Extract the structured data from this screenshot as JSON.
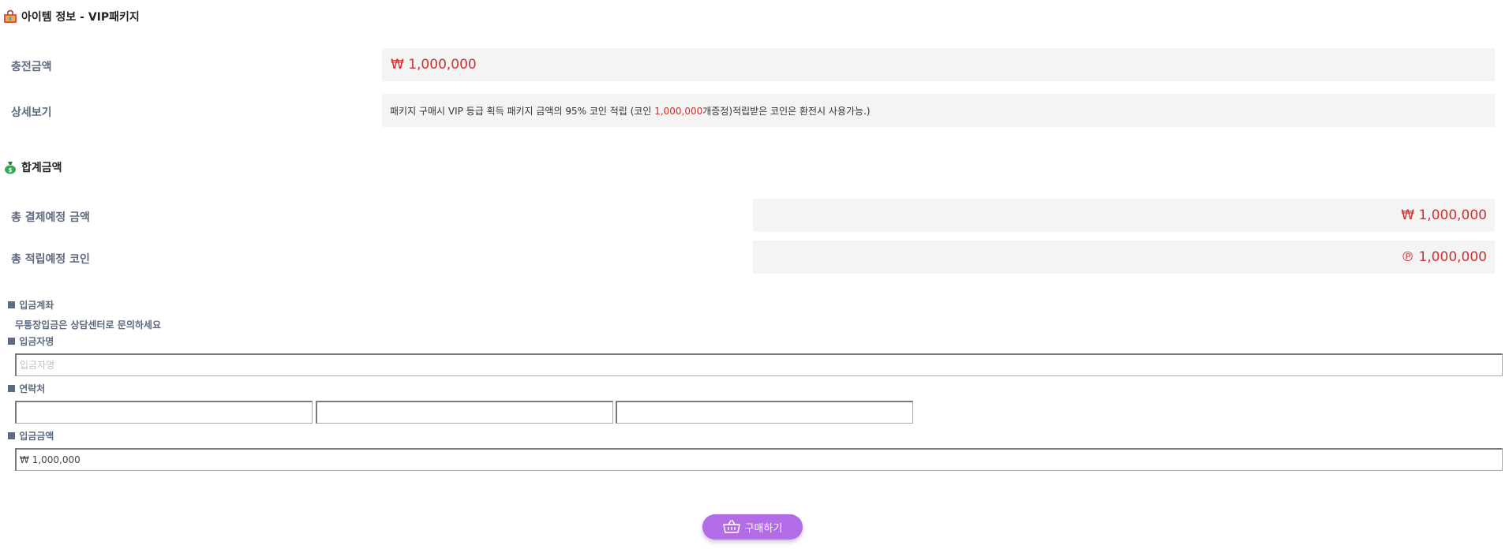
{
  "item_section": {
    "title": "아이템 정보 - VIP패키지",
    "charge_label": "충전금액",
    "charge_value": "₩ 1,000,000",
    "detail_label": "상세보기",
    "detail_text_before": "패키지 구매시 VIP 등급 획득 패키지 금액의 95% 코인 적립 (코인 ",
    "detail_text_highlight": "1,000,000",
    "detail_text_after": "개증정)적립받은 코인은 환전시 사용가능.)"
  },
  "total_section": {
    "title": "합계금액",
    "total_pay_label": "총 결제예정 금액",
    "total_pay_value": "₩ 1,000,000",
    "total_coin_label": "총 적립예정 코인",
    "total_coin_value": "℗ 1,000,000"
  },
  "deposit_form": {
    "account_heading": "입금계좌",
    "account_note": "무통장입금은 상담센터로 문의하세요",
    "depositor_heading": "입금자명",
    "depositor_placeholder": "입금자명",
    "depositor_value": "",
    "contact_heading": "연락처",
    "contact_values": [
      "",
      "",
      ""
    ],
    "amount_heading": "입금금액",
    "amount_value": "₩ 1,000,000"
  },
  "buy_button_label": "구매하기",
  "icons": {
    "item_icon": "shopping-bag-icon",
    "total_icon": "money-bag-icon",
    "buy_icon": "basket-icon"
  },
  "colors": {
    "accent_red": "#d32f2f",
    "label_gray_blue": "#5d6a80",
    "value_box_bg": "#f4f4f4",
    "button_purple": "#b16ce6"
  }
}
